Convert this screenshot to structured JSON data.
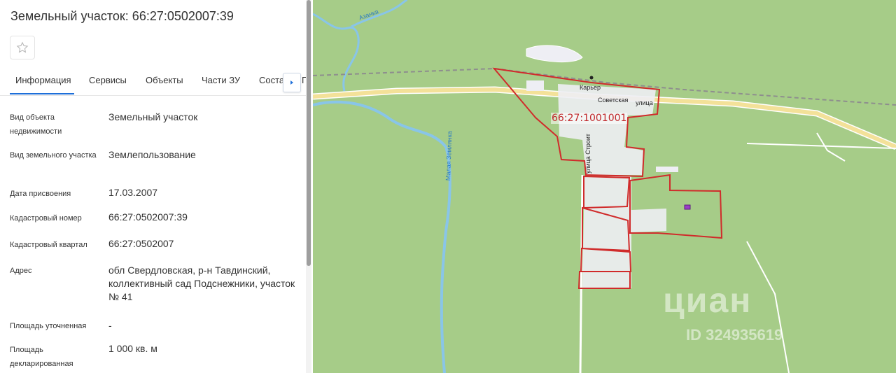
{
  "panel": {
    "title": "Земельный участок: 66:27:0502007:39",
    "favorite_icon": "star-icon",
    "tabs": [
      {
        "label": "Информация",
        "active": true
      },
      {
        "label": "Сервисы",
        "active": false
      },
      {
        "label": "Объекты",
        "active": false
      },
      {
        "label": "Части ЗУ",
        "active": false
      },
      {
        "label": "Соста",
        "active": false
      }
    ],
    "tabs_next_icon": "chevron-right-icon",
    "tab_cut_glyph": "Г",
    "rows": [
      {
        "label": "Вид объекта недвижимости",
        "value": "Земельный участок"
      },
      {
        "label": "Вид земельного участка",
        "value": "Землепользование"
      },
      {
        "label": "Дата присвоения",
        "value": "17.03.2007"
      },
      {
        "label": "Кадастровый номер",
        "value": "66:27:0502007:39"
      },
      {
        "label": "Кадастровый квартал",
        "value": "66:27:0502007"
      },
      {
        "label": "Адрес",
        "value": "обл Свердловская, р-н Тавдинский, коллективный сад Подснежники, участок № 41"
      },
      {
        "label": "Площадь уточненная",
        "value": "-"
      },
      {
        "label": "Площадь декларированная",
        "value": "1 000 кв. м"
      }
    ]
  },
  "map": {
    "cadastral_label": "66:27:1001001",
    "labels": {
      "karer": "Карьер",
      "sovetskaya": "Советская",
      "ulitsa": "улица",
      "stroiteley": "улица Строит",
      "river": "Малая Землянка",
      "river2": "Азанка"
    },
    "watermark": {
      "logo": "циан",
      "id": "ID 324935619"
    },
    "colors": {
      "background": "#a6cc88",
      "boundary": "#d02b2b",
      "road": "#f3e199",
      "water": "#89c5e8"
    }
  }
}
